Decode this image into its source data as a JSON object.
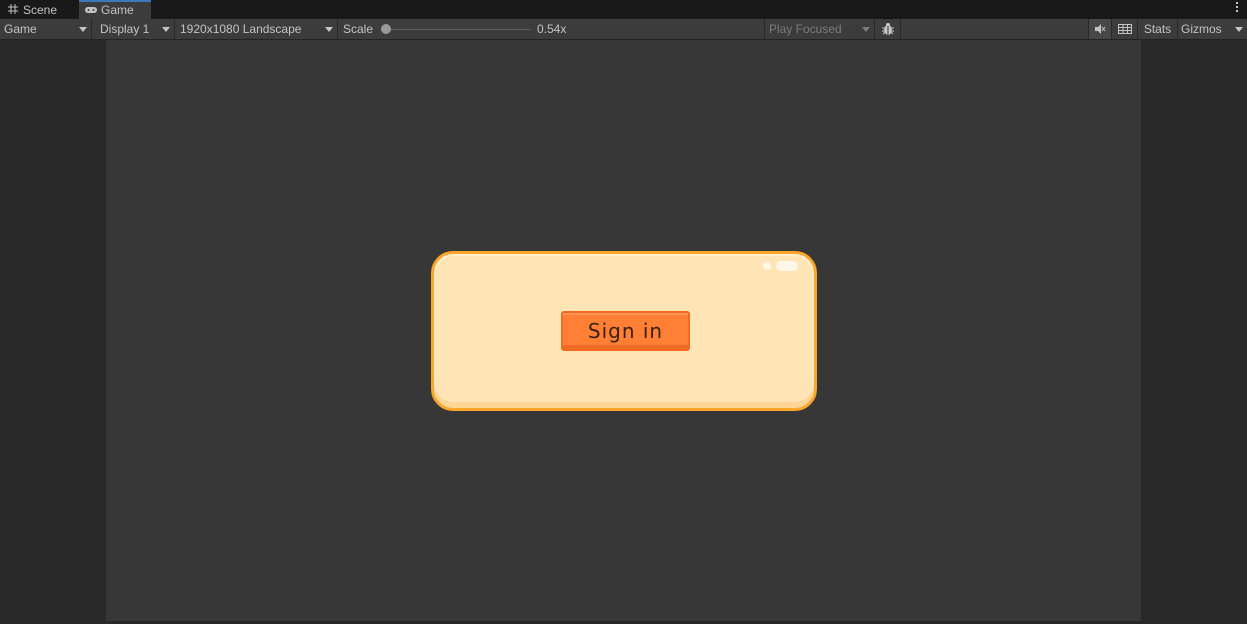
{
  "tabs": [
    {
      "label": "Scene",
      "icon": "grid-icon",
      "active": false
    },
    {
      "label": "Game",
      "icon": "gamepad-icon",
      "active": true
    }
  ],
  "toolbar": {
    "view_mode": "Game",
    "display": "Display 1",
    "resolution": "1920x1080 Landscape",
    "scale_label": "Scale",
    "scale_value": "0.54x",
    "play_mode": "Play Focused",
    "stats_label": "Stats",
    "gizmos_label": "Gizmos",
    "icons": [
      "bug-icon",
      "mute-audio-icon",
      "layout-grid-icon"
    ]
  },
  "game": {
    "button_label": "Sign in"
  },
  "colors": {
    "panel_fill": "#ffe5b6",
    "panel_border": "#fba52a",
    "button_fill": "#ff7f34",
    "viewport": "#373737"
  }
}
